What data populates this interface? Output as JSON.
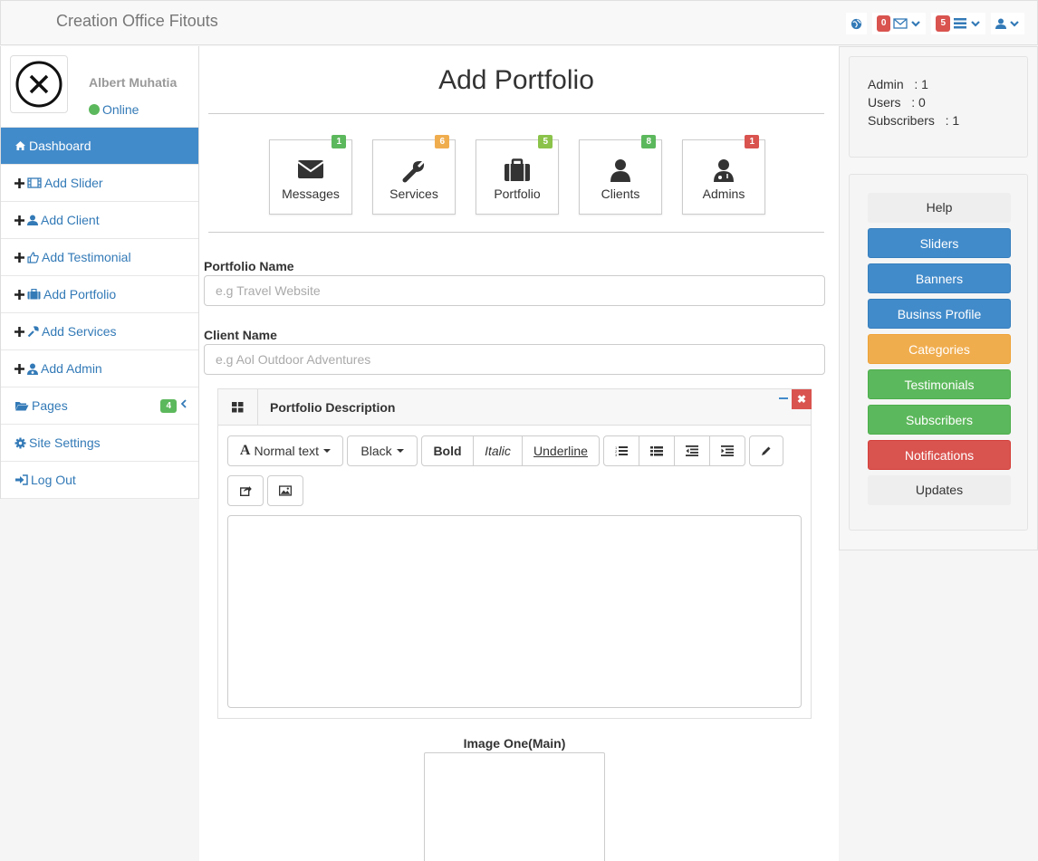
{
  "app": {
    "brand": "Creation Office Fitouts"
  },
  "topbar": {
    "mail_badge": "0",
    "list_badge": "5"
  },
  "user": {
    "name": "Albert Muhatia",
    "status": "Online"
  },
  "sidebar": {
    "items": [
      {
        "label": "Dashboard"
      },
      {
        "label": "Add Slider"
      },
      {
        "label": "Add Client"
      },
      {
        "label": "Add Testimonial"
      },
      {
        "label": "Add Portfolio"
      },
      {
        "label": "Add Services"
      },
      {
        "label": "Add Admin"
      },
      {
        "label": "Pages",
        "badge": "4"
      },
      {
        "label": "Site Settings"
      },
      {
        "label": "Log Out"
      }
    ]
  },
  "main": {
    "title": "Add Portfolio",
    "tiles": [
      {
        "label": "Messages",
        "badge": "1",
        "badge_color": "#5cb85c",
        "icon": "envelope-icon"
      },
      {
        "label": "Services",
        "badge": "6",
        "badge_color": "#f0ad4e",
        "icon": "wrench-icon"
      },
      {
        "label": "Portfolio",
        "badge": "5",
        "badge_color": "#8bc34a",
        "icon": "briefcase-icon"
      },
      {
        "label": "Clients",
        "badge": "8",
        "badge_color": "#5cb85c",
        "icon": "user-icon"
      },
      {
        "label": "Admins",
        "badge": "1",
        "badge_color": "#d9534f",
        "icon": "user-md-icon"
      }
    ],
    "form": {
      "portfolio_name_label": "Portfolio Name",
      "portfolio_name_placeholder": "e.g Travel Website",
      "client_name_label": "Client Name",
      "client_name_placeholder": "e.g Aol Outdoor Adventures"
    },
    "editor": {
      "title": "Portfolio Description",
      "style_dropdown": "Normal text",
      "color_dropdown": "Black",
      "bold": "Bold",
      "italic": "Italic",
      "underline": "Underline"
    },
    "image_one_label": "Image One(Main)"
  },
  "stats": {
    "admin": "Admin   : 1",
    "users": "Users   : 0",
    "subscribers": "Subscribers   : 1"
  },
  "right_links": [
    {
      "label": "Help",
      "style": "plain"
    },
    {
      "label": "Sliders",
      "style": "blue"
    },
    {
      "label": "Banners",
      "style": "blue"
    },
    {
      "label": "Businss Profile",
      "style": "blue"
    },
    {
      "label": "Categories",
      "style": "orange"
    },
    {
      "label": "Testimonials",
      "style": "green"
    },
    {
      "label": "Subscribers",
      "style": "green"
    },
    {
      "label": "Notifications",
      "style": "red"
    },
    {
      "label": "Updates",
      "style": "plain"
    }
  ]
}
